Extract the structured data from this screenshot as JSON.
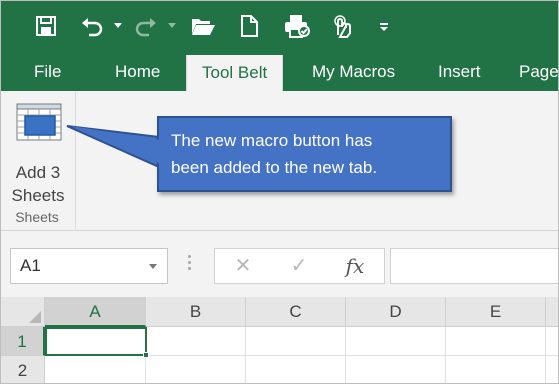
{
  "quick_access": {
    "icons": [
      "save-icon",
      "undo-icon",
      "redo-icon",
      "open-folder-icon",
      "new-document-icon",
      "print-preview-icon",
      "touch-mode-icon",
      "customize-toolbar-icon"
    ]
  },
  "ribbon_tabs": [
    {
      "label": "File"
    },
    {
      "label": "Home"
    },
    {
      "label": "Tool Belt"
    },
    {
      "label": "My Macros"
    },
    {
      "label": "Insert"
    },
    {
      "label": "Page"
    }
  ],
  "active_tab": "Tool Belt",
  "ribbon": {
    "group_label": "Sheets",
    "button_line1": "Add 3",
    "button_line2": "Sheets",
    "button_icon": "sheet-table-icon"
  },
  "callout": {
    "line1": "The new macro button has",
    "line2": "been added to the new tab."
  },
  "formula_bar": {
    "name_box": "A1",
    "cancel_symbol": "✕",
    "enter_symbol": "✓",
    "function_symbol": "fx",
    "value": ""
  },
  "grid": {
    "columns": [
      "A",
      "B",
      "C",
      "D",
      "E"
    ],
    "rows": [
      "1",
      "2"
    ],
    "active_cell": "A1"
  },
  "colors": {
    "excel_green": "#217346",
    "callout_blue": "#4472c4",
    "ribbon_bg": "#f3f3f3"
  }
}
